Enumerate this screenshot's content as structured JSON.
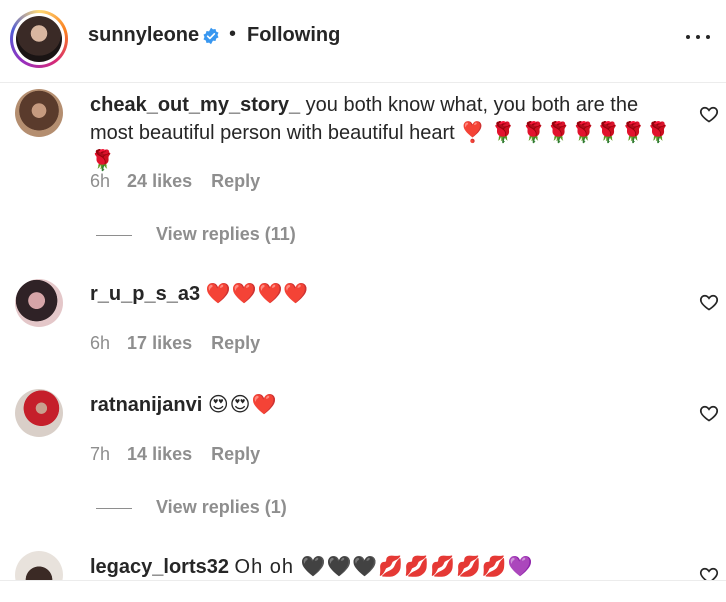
{
  "header": {
    "username": "sunnyleone",
    "separator": "•",
    "follow_status": "Following",
    "verified_color": "#3897f0"
  },
  "comments": [
    {
      "username": "cheak_out_my_story_",
      "text": "you both know what, you both are the most beautiful person with beautiful heart ❣️ 🌹 🌹🌹🌹🌹🌹🌹🌹",
      "time": "6h",
      "likes": "24 likes",
      "reply": "Reply",
      "view_replies": "View replies (11)"
    },
    {
      "username": "r_u_p_s_a3",
      "text": "❤️❤️❤️❤️",
      "time": "6h",
      "likes": "17 likes",
      "reply": "Reply"
    },
    {
      "username": "ratnanijanvi",
      "text": "😍😍❤️",
      "time": "7h",
      "likes": "14 likes",
      "reply": "Reply",
      "view_replies": "View replies (1)"
    },
    {
      "username": "legacy_lorts32",
      "text": "Oh oh 🖤🖤🖤💋💋💋💋💋💜"
    }
  ]
}
